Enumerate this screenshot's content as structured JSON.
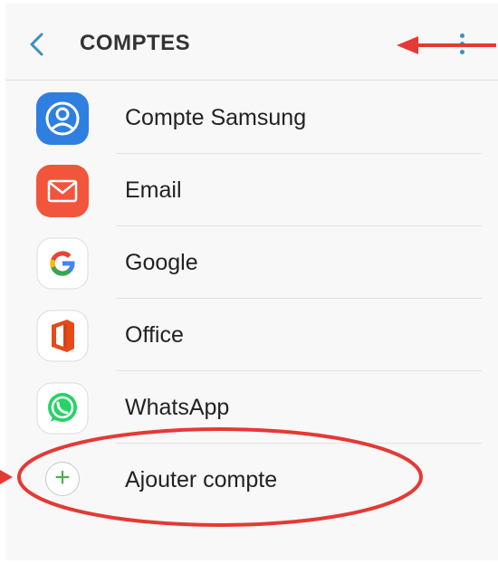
{
  "header": {
    "title": "COMPTES",
    "back_icon": "chevron-left-icon",
    "menu_icon": "more-vertical-icon"
  },
  "accounts": [
    {
      "label": "Compte Samsung",
      "icon": "samsung-account-icon",
      "color": "#2f7fe0"
    },
    {
      "label": "Email",
      "icon": "email-icon",
      "color": "#f2553c"
    },
    {
      "label": "Google",
      "icon": "google-icon",
      "color": "#ffffff"
    },
    {
      "label": "Office",
      "icon": "office-icon",
      "color": "#e64a19"
    },
    {
      "label": "WhatsApp",
      "icon": "whatsapp-icon",
      "color": "#25d366"
    }
  ],
  "add_account": {
    "label": "Ajouter compte",
    "icon": "plus-icon",
    "icon_color": "#4caf50"
  },
  "annotation": {
    "color": "#e53935"
  }
}
